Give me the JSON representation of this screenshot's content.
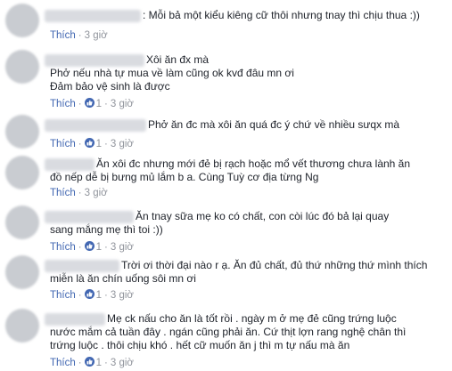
{
  "comments": [
    {
      "lines": [
        ": Mỗi bả một kiểu kiêng cữ thôi nhưng tnay thì chịu thua :))"
      ],
      "like_label": "Thích",
      "likes": "",
      "time": "3 giờ"
    },
    {
      "lines": [
        "Xôi ăn đx mà",
        "Phở nếu nhà tự mua về làm cũng ok kvđ đâu mn ơi",
        "Đảm bảo vệ sinh là được"
      ],
      "like_label": "Thích",
      "likes": "1",
      "time": "3 giờ"
    },
    {
      "lines": [
        "Phở ăn đc mà xôi ăn quá đc ý chứ về nhiều sưqx mà"
      ],
      "like_label": "Thích",
      "likes": "1",
      "time": "3 giờ"
    },
    {
      "lines": [
        "Ăn xôi đc nhưng mới đẻ bị rạch hoặc mổ vết thương chưa lành ăn",
        "đồ nếp dễ bị bưng mủ lắm b a. Cùng Tuỳ cơ địa từng Ng"
      ],
      "like_label": "Thích",
      "likes": "",
      "time": "3 giờ"
    },
    {
      "lines": [
        "Ăn tnay sữa mẹ ko có chất, con còi lúc đó bả lại quay",
        "sang mắng mẹ thì toi :))"
      ],
      "like_label": "Thích",
      "likes": "1",
      "time": "3 giờ"
    },
    {
      "lines": [
        "Trời ơi thời đại nào r ạ. Ăn đủ chất, đủ thứ những thứ mình thích",
        "miễn là ăn chín uống sôi mn ơi"
      ],
      "like_label": "Thích",
      "likes": "1",
      "time": "3 giờ"
    },
    {
      "lines": [
        "Mẹ ck nấu cho ăn là tốt rồi . ngày m ở mẹ đẻ cũng trứng luộc",
        "nước mắm cả tuần đây . ngán cũng phải ăn. Cứ thịt lợn rang nghệ chân thì",
        "trứng luộc . thôi chịu khó . hết cữ muốn ăn j thì m tự nấu mà ăn"
      ],
      "like_label": "Thích",
      "likes": "1",
      "time": "3 giờ"
    }
  ]
}
